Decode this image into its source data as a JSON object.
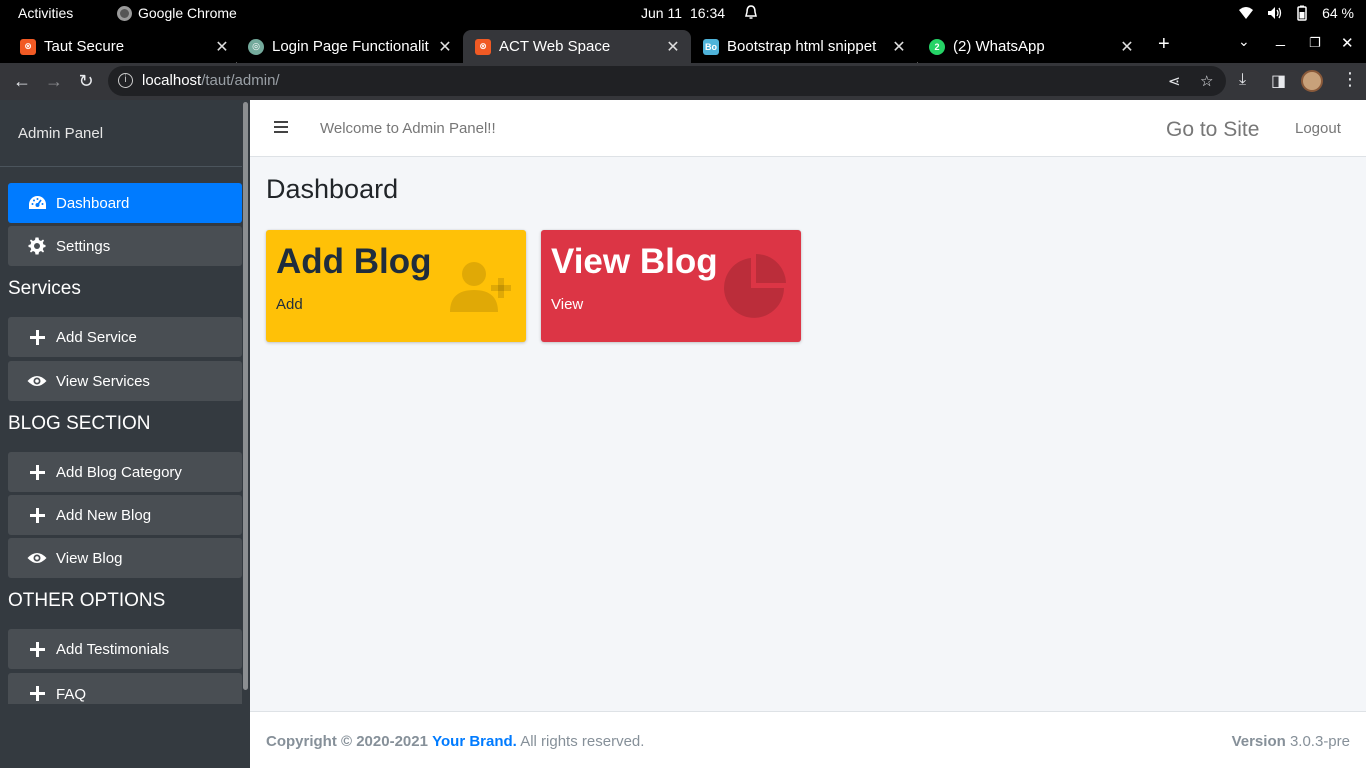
{
  "os_bar": {
    "activities": "Activities",
    "app_name": "Google Chrome",
    "date": "Jun 11",
    "time": "16:34",
    "battery": "64 %"
  },
  "tabs": [
    {
      "title": "Taut Secure",
      "favicon_color": "#f15a24",
      "favicon_text": "",
      "active": false
    },
    {
      "title": "Login Page Functionalit",
      "favicon_color": "#74aa9c",
      "favicon_text": "",
      "active": false
    },
    {
      "title": "ACT Web Space",
      "favicon_color": "#f15a24",
      "favicon_text": "",
      "active": true
    },
    {
      "title": "Bootstrap html snippet",
      "favicon_color": "#4fb3d9",
      "favicon_text": "Bo",
      "active": false
    },
    {
      "title": "(2) WhatsApp",
      "favicon_color": "#25d366",
      "favicon_text": "2",
      "active": false
    }
  ],
  "address": {
    "host": "localhost",
    "path": "/taut/admin/"
  },
  "sidebar": {
    "brand": "Admin Panel",
    "items": {
      "dashboard": "Dashboard",
      "settings": "Settings",
      "services_header": "Services",
      "add_service": "Add Service",
      "view_services": "View Services",
      "blog_header": "BLOG SECTION",
      "add_blog_category": "Add Blog Category",
      "add_new_blog": "Add New Blog",
      "view_blog": "View Blog",
      "other_header": "OTHER OPTIONS",
      "add_testimonials": "Add Testimonials",
      "faq": "FAQ"
    }
  },
  "header": {
    "welcome": "Welcome to Admin Panel!!",
    "go_to_site": "Go to Site",
    "logout": "Logout"
  },
  "content": {
    "title": "Dashboard",
    "boxes": [
      {
        "title": "Add Blog",
        "link": "Add",
        "color": "#ffc107",
        "icon": "user-plus-icon"
      },
      {
        "title": "View Blog",
        "link": "View",
        "color": "#dc3545",
        "icon": "chart-pie-icon"
      }
    ]
  },
  "footer": {
    "copyright": "Copyright © 2020-2021",
    "brand": "Your Brand.",
    "rights": "All rights reserved.",
    "version_label": "Version",
    "version": "3.0.3-pre"
  },
  "colors": {
    "primary": "#007bff",
    "sidebar_bg": "#343a40",
    "warning": "#ffc107",
    "danger": "#dc3545"
  }
}
